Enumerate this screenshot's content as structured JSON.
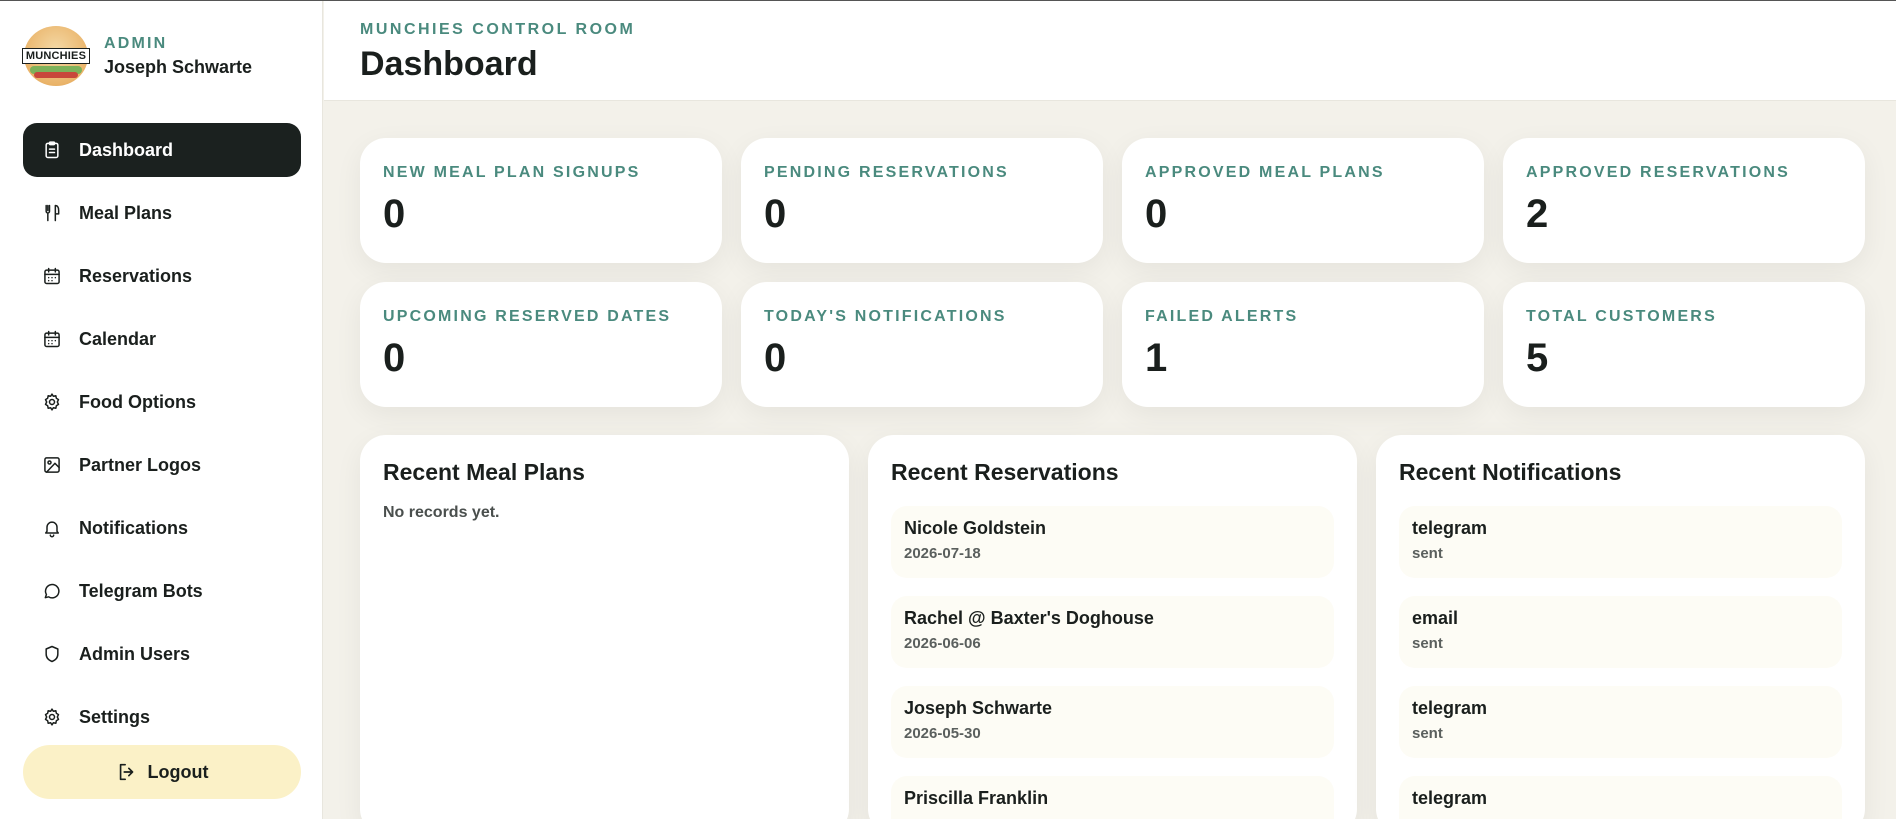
{
  "brand": {
    "logo_text": "MUNCHIES",
    "role": "ADMIN",
    "user_name": "Joseph Schwarte"
  },
  "nav": {
    "items": [
      {
        "label": "Dashboard",
        "icon": "clipboard-icon",
        "active": true
      },
      {
        "label": "Meal Plans",
        "icon": "fork-knife-icon"
      },
      {
        "label": "Reservations",
        "icon": "calendar-icon"
      },
      {
        "label": "Calendar",
        "icon": "calendar-icon"
      },
      {
        "label": "Food Options",
        "icon": "gear-icon"
      },
      {
        "label": "Partner Logos",
        "icon": "image-icon"
      },
      {
        "label": "Notifications",
        "icon": "bell-icon"
      },
      {
        "label": "Telegram Bots",
        "icon": "chat-bubble-icon"
      },
      {
        "label": "Admin Users",
        "icon": "shield-icon"
      },
      {
        "label": "Settings",
        "icon": "gear-icon"
      }
    ],
    "logout_label": "Logout"
  },
  "header": {
    "eyebrow": "MUNCHIES CONTROL ROOM",
    "title": "Dashboard"
  },
  "stats": [
    {
      "label": "NEW MEAL PLAN SIGNUPS",
      "value": "0"
    },
    {
      "label": "PENDING RESERVATIONS",
      "value": "0"
    },
    {
      "label": "APPROVED MEAL PLANS",
      "value": "0"
    },
    {
      "label": "APPROVED RESERVATIONS",
      "value": "2"
    },
    {
      "label": "UPCOMING RESERVED DATES",
      "value": "0"
    },
    {
      "label": "TODAY'S NOTIFICATIONS",
      "value": "0"
    },
    {
      "label": "FAILED ALERTS",
      "value": "1"
    },
    {
      "label": "TOTAL CUSTOMERS",
      "value": "5"
    }
  ],
  "panels": {
    "meal_plans": {
      "title": "Recent Meal Plans",
      "empty_text": "No records yet."
    },
    "reservations": {
      "title": "Recent Reservations",
      "rows": [
        {
          "title": "Nicole Goldstein",
          "sub": "2026-07-18"
        },
        {
          "title": "Rachel @ Baxter's Doghouse",
          "sub": "2026-06-06"
        },
        {
          "title": "Joseph Schwarte",
          "sub": "2026-05-30"
        },
        {
          "title": "Priscilla Franklin",
          "sub": ""
        }
      ]
    },
    "notifications": {
      "title": "Recent Notifications",
      "rows": [
        {
          "title": "telegram",
          "sub": "sent"
        },
        {
          "title": "email",
          "sub": "sent"
        },
        {
          "title": "telegram",
          "sub": "sent"
        },
        {
          "title": "telegram",
          "sub": ""
        }
      ]
    }
  },
  "colors": {
    "accent_teal": "#4a8a7e",
    "sidebar_active": "#1b211f",
    "logout_bg": "#fbf1c7",
    "page_bg": "#f3f1ea"
  }
}
